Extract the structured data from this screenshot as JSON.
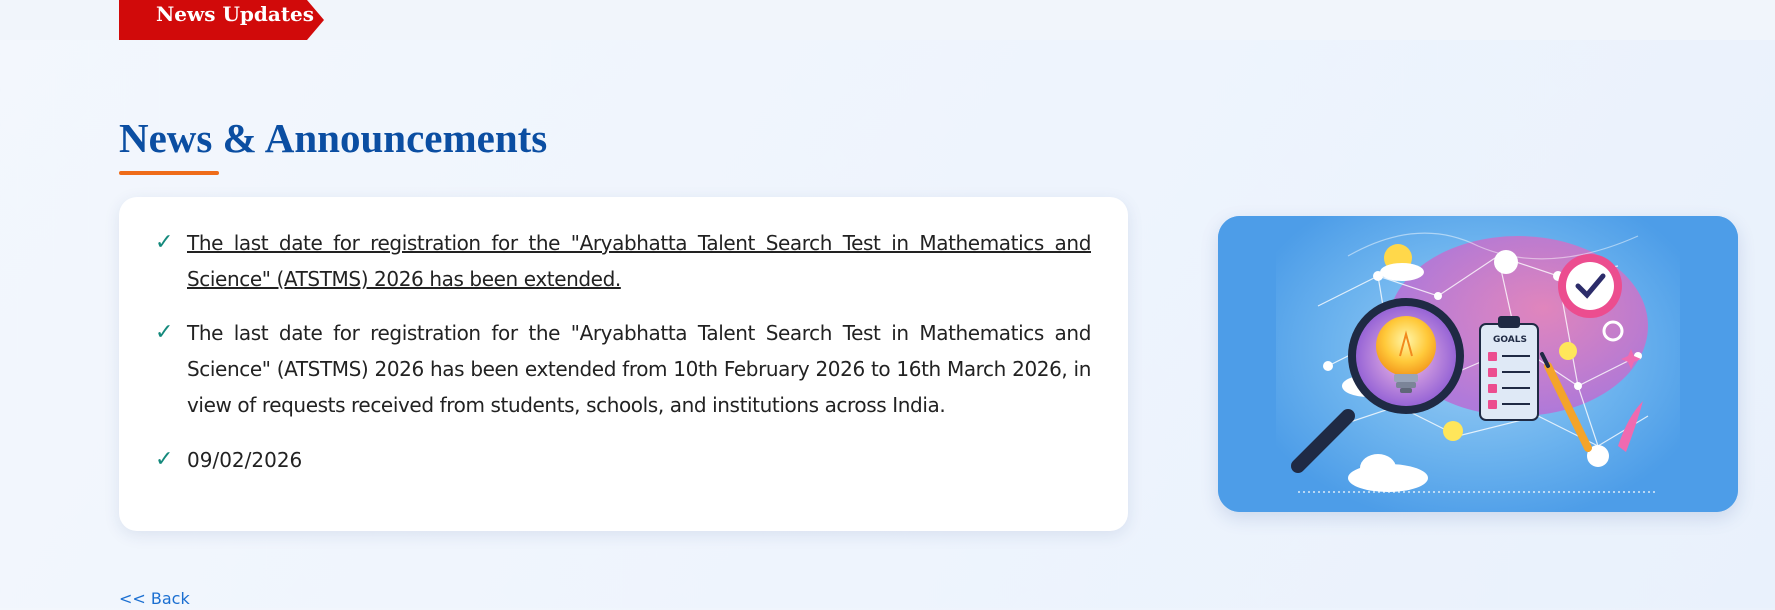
{
  "ribbon": {
    "label": "News Updates",
    "color": "#d10a0a"
  },
  "section": {
    "title": "News & Announcements",
    "title_color": "#0b4ea2",
    "underline_color": "#ef6c1a"
  },
  "news": {
    "headline_link": "The last date for registration for the \"Aryabhatta Talent Search Test in Mathematics and Science\" (ATSTMS) 2026 has been extended.",
    "body": "The last date for registration for the \"Aryabhatta Talent Search Test in Mathematics and Science\" (ATSTMS) 2026 has been extended from 10th February 2026 to 16th March 2026, in view of requests received from students, schools, and institutions across India.",
    "date": "09/02/2026",
    "bullet_icon": "check-icon",
    "bullet_color": "#14897c"
  },
  "illustration": {
    "goals_label": "GOALS"
  },
  "navigation": {
    "back_label": "<< Back"
  }
}
